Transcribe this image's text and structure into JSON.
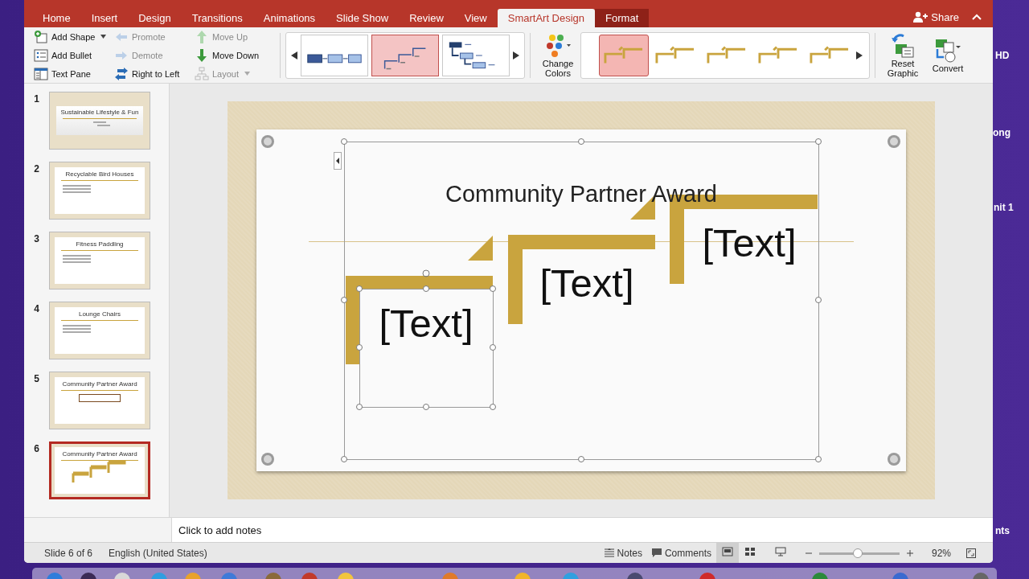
{
  "tabs": [
    {
      "label": "Home",
      "selected": false,
      "contextual": false
    },
    {
      "label": "Insert",
      "selected": false,
      "contextual": false
    },
    {
      "label": "Design",
      "selected": false,
      "contextual": false
    },
    {
      "label": "Transitions",
      "selected": false,
      "contextual": false
    },
    {
      "label": "Animations",
      "selected": false,
      "contextual": false
    },
    {
      "label": "Slide Show",
      "selected": false,
      "contextual": false
    },
    {
      "label": "Review",
      "selected": false,
      "contextual": false
    },
    {
      "label": "View",
      "selected": false,
      "contextual": false
    },
    {
      "label": "SmartArt Design",
      "selected": true,
      "contextual": true
    },
    {
      "label": "Format",
      "selected": false,
      "contextual": true
    }
  ],
  "share": {
    "label": "Share"
  },
  "ribbon": {
    "command_columns": [
      [
        {
          "label": "Add Shape",
          "disabled": false,
          "menu": true
        },
        {
          "label": "Add Bullet",
          "disabled": false,
          "menu": false
        },
        {
          "label": "Text Pane",
          "disabled": false,
          "menu": false
        }
      ],
      [
        {
          "label": "Promote",
          "disabled": true,
          "menu": false
        },
        {
          "label": "Demote",
          "disabled": true,
          "menu": false
        },
        {
          "label": "Right to Left",
          "disabled": false,
          "menu": false
        }
      ],
      [
        {
          "label": "Move Up",
          "disabled": true,
          "menu": false
        },
        {
          "label": "Move Down",
          "disabled": false,
          "menu": false
        },
        {
          "label": "Layout",
          "disabled": true,
          "menu": true
        }
      ]
    ],
    "layouts": [
      {
        "kind": "process",
        "selected": false
      },
      {
        "kind": "step-up",
        "selected": true
      },
      {
        "kind": "hierarchy",
        "selected": false
      }
    ],
    "change_colors": "Change Colors",
    "styles": [
      {
        "selected": true
      },
      {
        "selected": false
      },
      {
        "selected": false
      },
      {
        "selected": false
      },
      {
        "selected": false
      }
    ],
    "reset": "Reset Graphic",
    "convert": "Convert"
  },
  "thumbnails": [
    {
      "number": "1",
      "kind": "title",
      "title": "Sustainable Lifestyle & Fun",
      "selected": false
    },
    {
      "number": "2",
      "kind": "bullets",
      "title": "Recyclable Bird Houses",
      "selected": false
    },
    {
      "number": "3",
      "kind": "bullets",
      "title": "Fitness Paddling",
      "selected": false
    },
    {
      "number": "4",
      "kind": "bullets",
      "title": "Lounge Chairs",
      "selected": false
    },
    {
      "number": "5",
      "kind": "box",
      "title": "Community Partner Award",
      "selected": false
    },
    {
      "number": "6",
      "kind": "smartart",
      "title": "Community Partner Award",
      "selected": true
    }
  ],
  "slide": {
    "title": "Community Partner Award",
    "placeholders": [
      "[Text]",
      "[Text]",
      "[Text]"
    ]
  },
  "notes": {
    "placeholder": "Click to add notes"
  },
  "status_bar": {
    "slide": "Slide 6 of 6",
    "language": "English (United States)",
    "notes": "Notes",
    "comments": "Comments",
    "zoom": {
      "level": 0.48
    },
    "zoom_reading": "92%"
  },
  "desktop_labels": [
    "HD",
    "ong",
    "nit 1",
    "nts"
  ]
}
